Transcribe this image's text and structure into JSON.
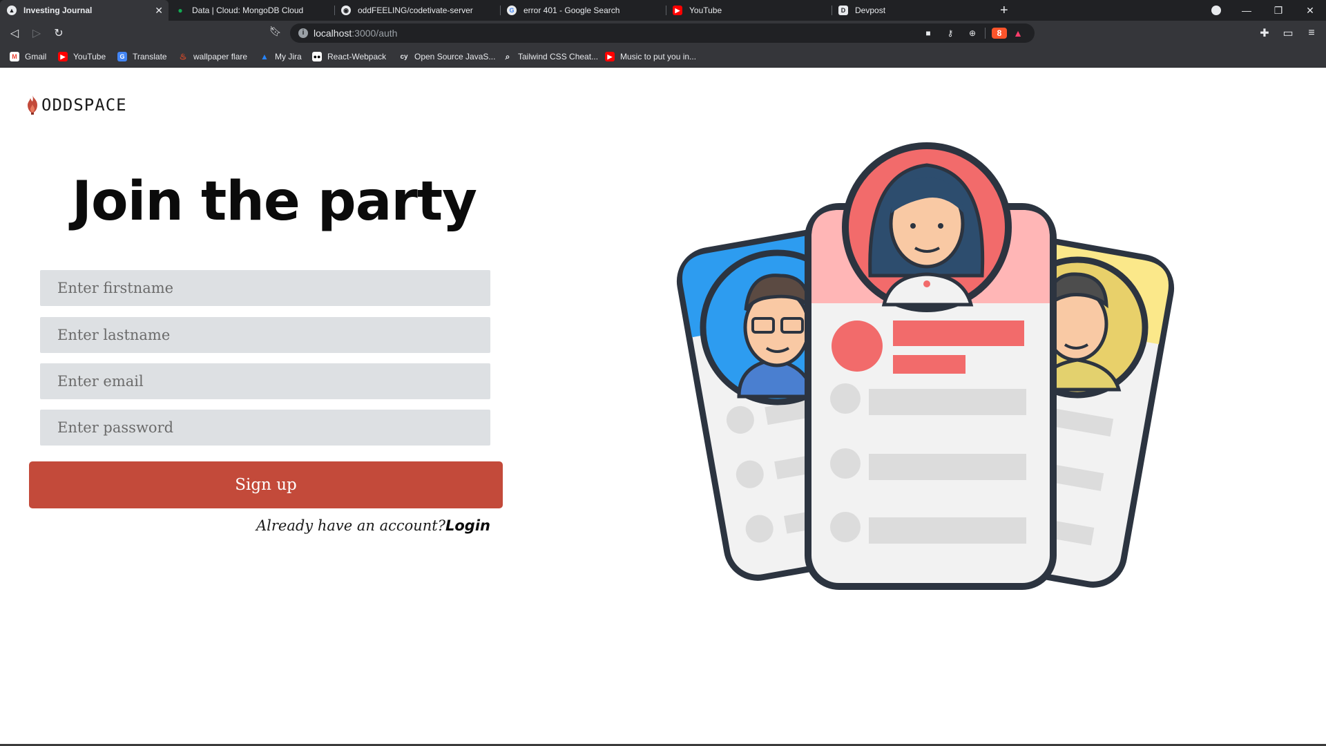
{
  "browser": {
    "tabs": [
      {
        "label": "Investing Journal",
        "active": true,
        "favicon": "triangle-icon"
      },
      {
        "label": "Data | Cloud: MongoDB Cloud",
        "active": false,
        "favicon": "leaf-icon"
      },
      {
        "label": "oddFEELING/codetivate-server",
        "active": false,
        "favicon": "github-icon"
      },
      {
        "label": "error 401 - Google Search",
        "active": false,
        "favicon": "google-icon"
      },
      {
        "label": "YouTube",
        "active": false,
        "favicon": "youtube-icon"
      },
      {
        "label": "Devpost",
        "active": false,
        "favicon": "devpost-icon"
      }
    ],
    "address": {
      "host": "localhost",
      "path": ":3000/auth"
    },
    "shield_count": "8",
    "bookmarks": [
      {
        "label": "Gmail",
        "icon": "gmail-icon",
        "color": "#ea4335"
      },
      {
        "label": "YouTube",
        "icon": "youtube-icon",
        "color": "#ff0000"
      },
      {
        "label": "Translate",
        "icon": "translate-icon",
        "color": "#4285f4"
      },
      {
        "label": "wallpaper flare",
        "icon": "flame-icon",
        "color": "#d44a2a"
      },
      {
        "label": "My Jira",
        "icon": "jira-icon",
        "color": "#2684ff"
      },
      {
        "label": "React-Webpack",
        "icon": "medium-icon",
        "color": "#ffffff"
      },
      {
        "label": "Open Source JavaS...",
        "icon": "cy-icon",
        "color": "#35363a"
      },
      {
        "label": "Tailwind CSS Cheat...",
        "icon": "search-icon",
        "color": "#35363a"
      },
      {
        "label": "Music to put you in...",
        "icon": "youtube-icon",
        "color": "#ff0000"
      }
    ]
  },
  "brand": {
    "name": "ODDSPACE",
    "accent": "#c34a3a"
  },
  "form": {
    "heading": "Join the party",
    "firstname_placeholder": "Enter firstname",
    "lastname_placeholder": "Enter lastname",
    "email_placeholder": "Enter email",
    "password_placeholder": "Enter password",
    "submit_label": "Sign up",
    "login_prompt": "Already have an account?",
    "login_link": "Login"
  },
  "colors": {
    "field_bg": "#dde0e3",
    "button_bg": "#c34a3a",
    "card_blue": "#2d9cf0",
    "card_pink": "#ffb6b6",
    "card_yellow": "#fbe88a",
    "outline": "#2c3440"
  }
}
